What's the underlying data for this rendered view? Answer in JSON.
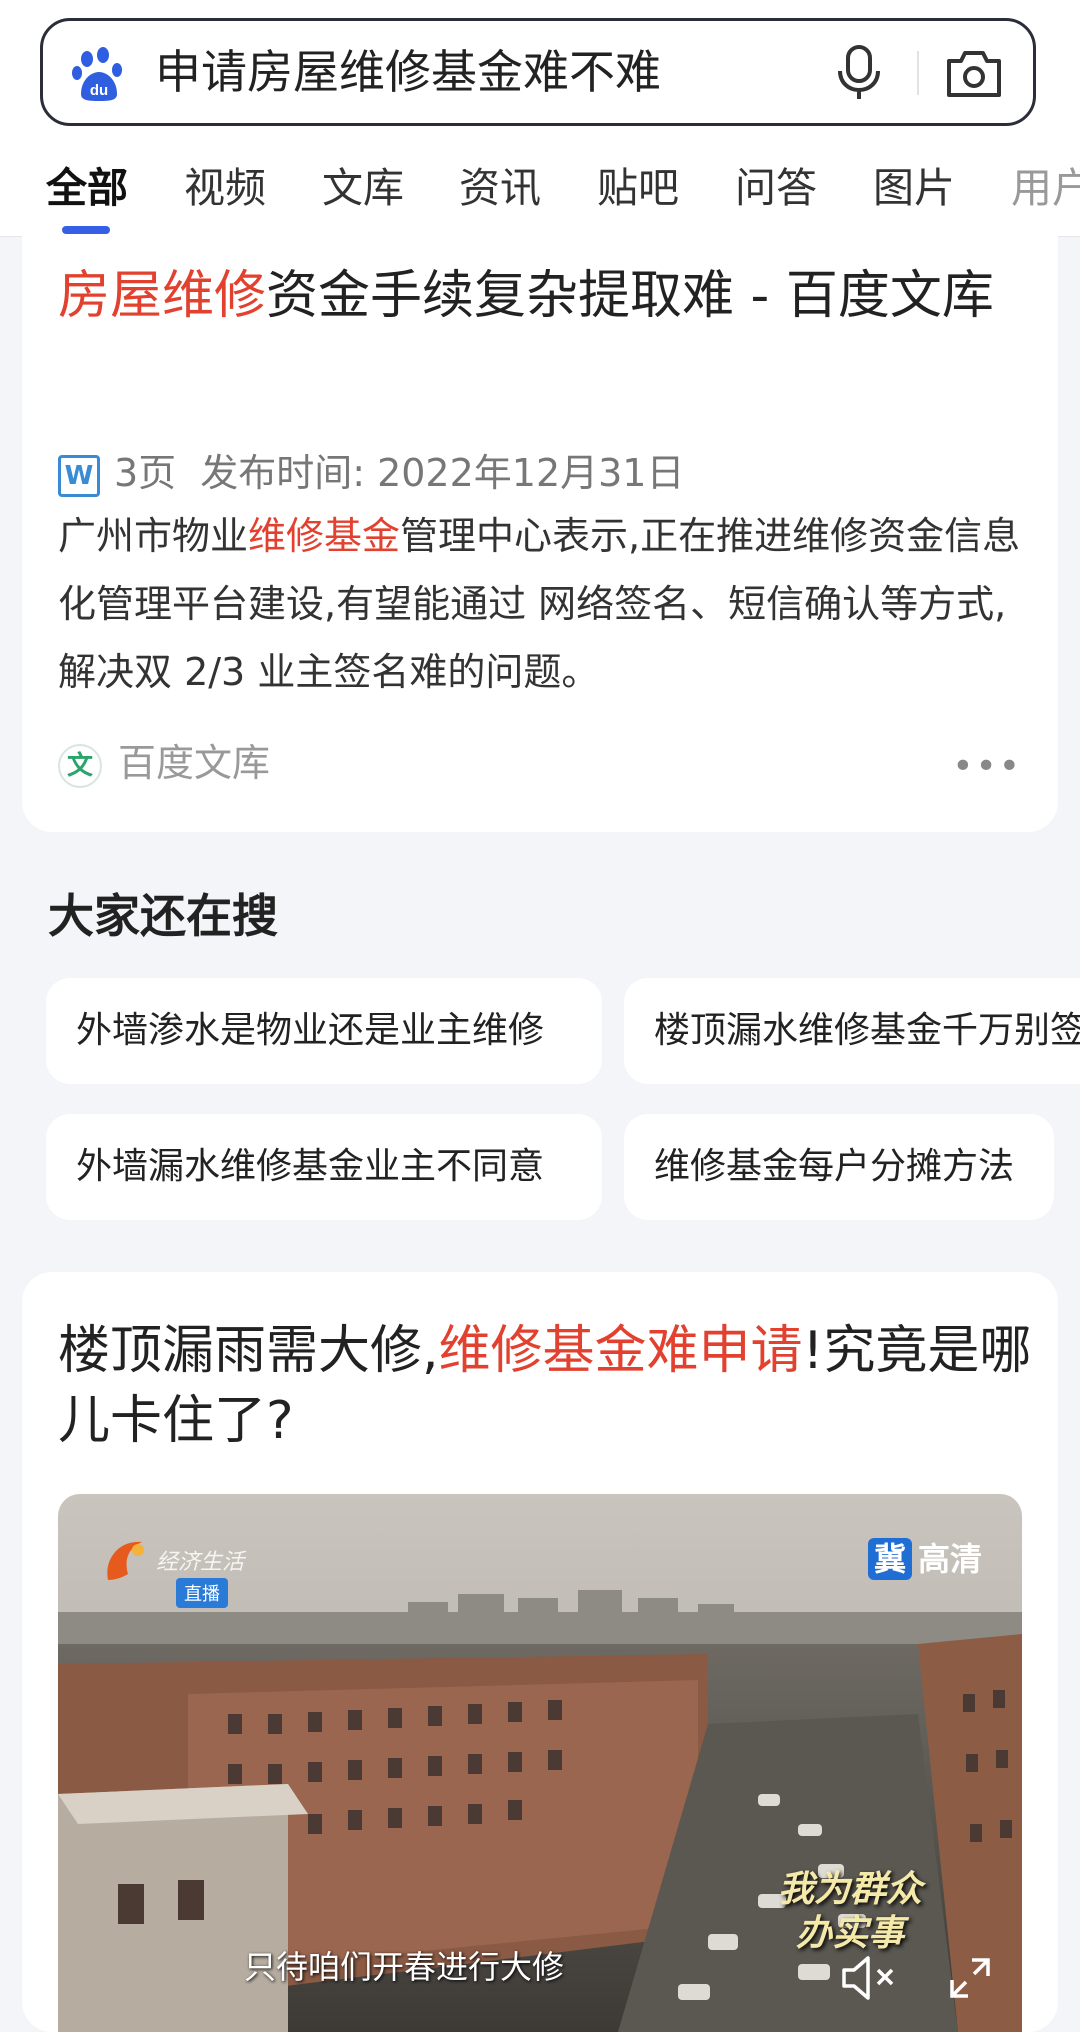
{
  "search": {
    "query": "申请房屋维修基金难不难"
  },
  "tabs": [
    "全部",
    "视频",
    "文库",
    "资讯",
    "贴吧",
    "问答",
    "图片",
    "用户"
  ],
  "result1": {
    "title_highlight": "房屋维修",
    "title_rest": "资金手续复杂提取难 - 百度文库",
    "doc_icon_letter": "W",
    "pages": "3页",
    "publish_label": "发布时间: 2022年12月31日",
    "snippet_before": "广州市物业",
    "snippet_highlight": "维修基金",
    "snippet_after": "管理中心表示,正在推进维修资金信息化管理平台建设,有望能通过 网络签名、短信确认等方式,解决双 2/3 业主签名难的问题。",
    "source_icon_letter": "文",
    "source": "百度文库",
    "more": "•••"
  },
  "related": {
    "title": "大家还在搜",
    "items": [
      "外墙渗水是物业还是业主维修",
      "楼顶漏水维修基金千万别签",
      "外墙漏水维修基金业主不同意",
      "维修基金每户分摊方法"
    ]
  },
  "result2": {
    "title_before": "楼顶漏雨需大修,",
    "title_highlight": "维修基金难申请",
    "title_after": "!究竟是哪儿卡住了?",
    "video": {
      "channel_logo_text": "经济生活",
      "live_badge": "直播",
      "hd_brand": "冀",
      "hd_label": "高清",
      "slogan_line1": "我为群众",
      "slogan_line2": "办实事",
      "subtitle": "只待咱们开春进行大修"
    }
  },
  "colors": {
    "highlight": "#e2412f",
    "tab_underline": "#3560e6",
    "background": "#f4f5f9"
  }
}
